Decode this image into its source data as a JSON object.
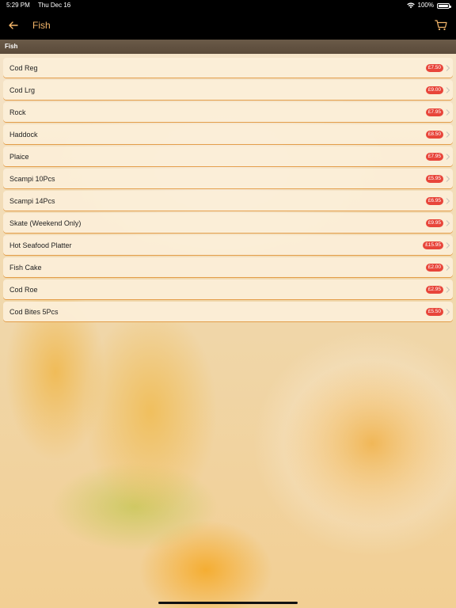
{
  "status_bar": {
    "time": "5:29 PM",
    "date": "Thu Dec 16",
    "battery": "100%"
  },
  "nav": {
    "title": "Fish",
    "back_icon": "arrow-left-icon",
    "cart_icon": "cart-icon"
  },
  "section": {
    "title": "Fish"
  },
  "items": [
    {
      "name": "Cod Reg",
      "price": "£7.50"
    },
    {
      "name": "Cod Lrg",
      "price": "£9.00"
    },
    {
      "name": "Rock",
      "price": "£7.95"
    },
    {
      "name": "Haddock",
      "price": "£8.50"
    },
    {
      "name": "Plaice",
      "price": "£7.95"
    },
    {
      "name": "Scampi 10Pcs",
      "price": "£5.95"
    },
    {
      "name": "Scampi 14Pcs",
      "price": "£6.95"
    },
    {
      "name": "Skate (Weekend Only)",
      "price": "£9.95"
    },
    {
      "name": "Hot Seafood Platter",
      "price": "£15.95"
    },
    {
      "name": "Fish Cake",
      "price": "£2.00"
    },
    {
      "name": "Cod Roe",
      "price": "£2.95"
    },
    {
      "name": "Cod Bites 5Pcs",
      "price": "£5.50"
    }
  ],
  "colors": {
    "accent": "#f4b66a",
    "price_badge": "#e8453a",
    "nav_bg": "#000000"
  }
}
